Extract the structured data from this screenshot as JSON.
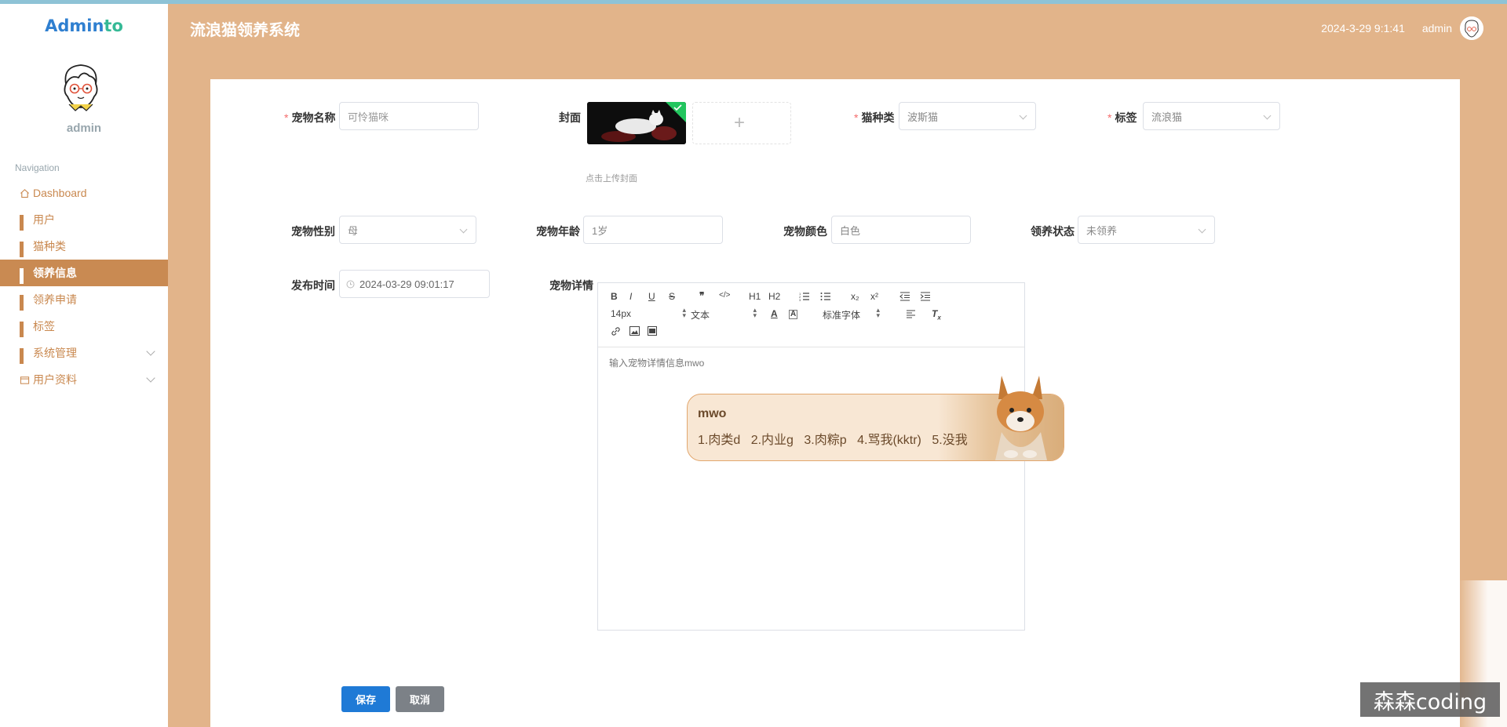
{
  "sidebar": {
    "logo_part1": "Admin",
    "logo_part2": "to",
    "user_name": "admin",
    "nav_title": "Navigation",
    "items": [
      {
        "label": "Dashboard",
        "icon": "home-icon"
      },
      {
        "label": "用户",
        "icon": "grid-icon"
      },
      {
        "label": "猫种类",
        "icon": "grid-icon"
      },
      {
        "label": "领养信息",
        "icon": "grid-icon",
        "active": true
      },
      {
        "label": "领养申请",
        "icon": "grid-icon"
      },
      {
        "label": "标签",
        "icon": "grid-icon"
      },
      {
        "label": "系统管理",
        "icon": "grid-icon",
        "expandable": true
      },
      {
        "label": "用户资料",
        "icon": "folder-icon",
        "expandable": true
      }
    ]
  },
  "header": {
    "title": "流浪猫领养系统",
    "datetime": "2024-3-29 9:1:41",
    "user": "admin"
  },
  "form": {
    "pet_name": {
      "label": "宠物名称",
      "required": true,
      "placeholder": "可怜猫咪"
    },
    "cover": {
      "label": "封面",
      "hint": "点击上传封面"
    },
    "breed": {
      "label": "猫种类",
      "required": true,
      "value": "波斯猫"
    },
    "tag": {
      "label": "标签",
      "required": true,
      "value": "流浪猫"
    },
    "gender": {
      "label": "宠物性别",
      "value": "母"
    },
    "age": {
      "label": "宠物年龄",
      "value": "1岁"
    },
    "color": {
      "label": "宠物颜色",
      "value": "白色"
    },
    "status": {
      "label": "领养状态",
      "value": "未领养"
    },
    "publish_time": {
      "label": "发布时间",
      "value": "2024-03-29 09:01:17"
    },
    "detail": {
      "label": "宠物详情",
      "toolbar": {
        "bold": "B",
        "italic": "I",
        "underline": "U",
        "strike": "S",
        "quote": "❞",
        "code": "</>",
        "h1": "H1",
        "h2": "H2",
        "sub": "x₂",
        "sup": "x²",
        "size": "14px",
        "format": "文本",
        "font": "标准字体"
      },
      "content": "输入宠物详情信息mwo"
    }
  },
  "ime": {
    "input": "mwo",
    "candidates": [
      "1.肉类d",
      "2.内业g",
      "3.肉粽p",
      "4.骂我(kktr)",
      "5.没我"
    ]
  },
  "buttons": {
    "save": "保存",
    "cancel": "取消"
  },
  "watermark": "森森coding",
  "colors": {
    "header_bg": "#e2b48a",
    "sidebar_active": "#c98a52",
    "nav_text": "#c9884f",
    "save_button": "#1f7ad6",
    "cancel_button": "#7c8187"
  }
}
